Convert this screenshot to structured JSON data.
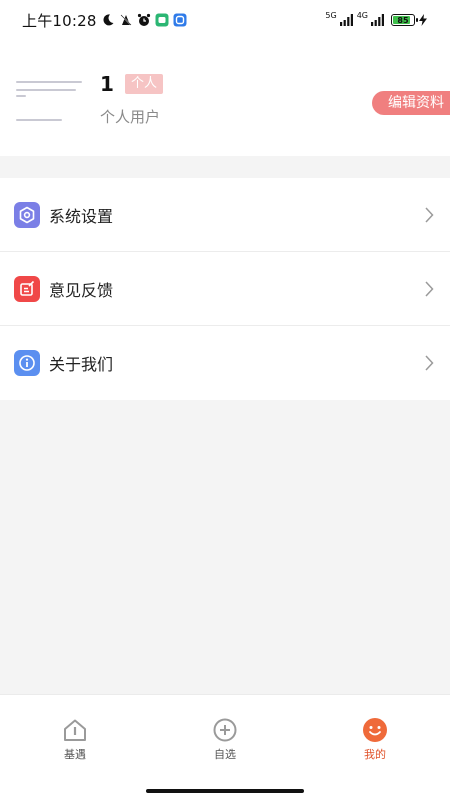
{
  "status_bar": {
    "time": "上午10:28",
    "network_1": "5G",
    "network_2": "4G",
    "battery": "85",
    "icons": [
      "moon-icon",
      "vibrate-icon",
      "alarm-icon",
      "app-icon",
      "app-icon-2",
      "charging-icon"
    ]
  },
  "profile": {
    "number": "1",
    "tag": "个人",
    "type": "个人用户",
    "edit_label": "编辑资料"
  },
  "menu": {
    "items": [
      {
        "label": "系统设置",
        "icon": "settings-icon",
        "color": "#7b7fe6"
      },
      {
        "label": "意见反馈",
        "icon": "feedback-icon",
        "color": "#f04848"
      },
      {
        "label": "关于我们",
        "icon": "info-icon",
        "color": "#5b8ff0"
      }
    ]
  },
  "nav": {
    "items": [
      {
        "label": "基遇",
        "icon": "home-icon"
      },
      {
        "label": "自选",
        "icon": "add-circle-icon"
      },
      {
        "label": "我的",
        "icon": "smiley-icon",
        "active": true
      }
    ]
  },
  "colors": {
    "accent": "#e0522a",
    "edit_button": "#f07f7f",
    "tag": "#f6c4c4"
  }
}
